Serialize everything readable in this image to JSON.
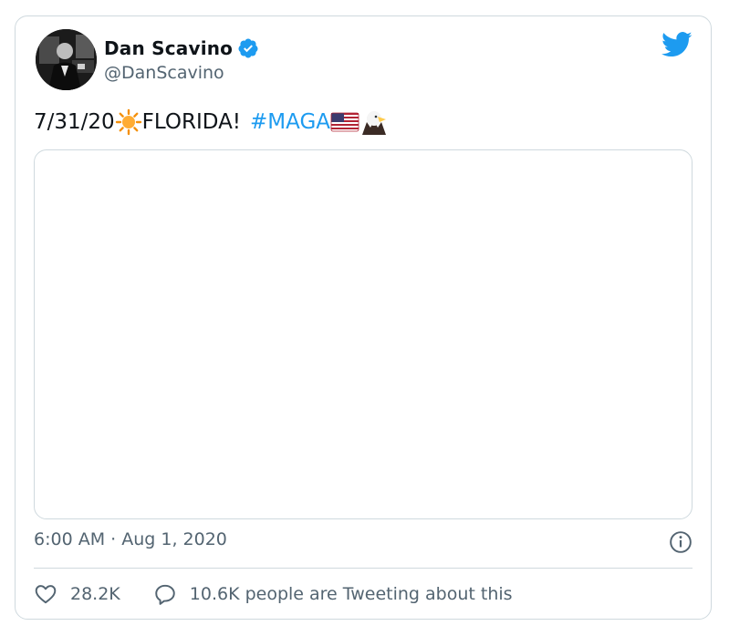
{
  "tweet": {
    "author_name": "Dan Scavino",
    "author_handle": "@DanScavino",
    "text_main": "7/31/20",
    "text_place": "FLORIDA!",
    "hashtag": "#MAGA",
    "timestamp": "6:00 AM · Aug 1, 2020",
    "likes": "28.2K",
    "tweeting_about": "10.6K people are Tweeting about this"
  },
  "icons": {
    "verified": "verified-badge-icon",
    "logo": "twitter-bird-icon",
    "info": "info-icon",
    "like": "heart-icon",
    "reply": "speech-bubble-icon",
    "sun": "sun-emoji",
    "flag": "us-flag-emoji",
    "eagle": "eagle-emoji"
  },
  "colors": {
    "accent": "#1d9bf0",
    "text": "#0f1419",
    "muted": "#536471",
    "border": "#cfd9de"
  }
}
